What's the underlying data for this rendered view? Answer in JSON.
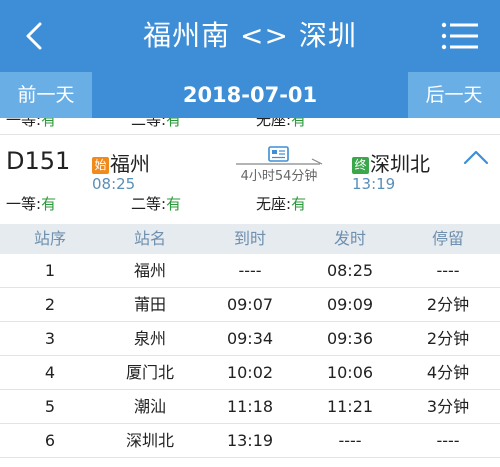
{
  "header": {
    "title": "福州南 <> 深圳",
    "back_icon": "chevron-left-icon",
    "menu_icon": "hamburger-menu-icon"
  },
  "datebar": {
    "prev_label": "前一天",
    "date": "2018-07-01",
    "next_label": "后一天"
  },
  "prev_train_seats": {
    "first_class": {
      "label": "一等:",
      "value": "有"
    },
    "second_class": {
      "label": "二等:",
      "value": "有"
    },
    "no_seat": {
      "label": "无座:",
      "value": "有"
    }
  },
  "train": {
    "code": "D151",
    "departure": {
      "badge": "始",
      "station": "福州",
      "time": "08:25"
    },
    "arrival": {
      "badge": "终",
      "station": "深圳北",
      "time": "13:19"
    },
    "duration": "4小时54分钟",
    "seats": {
      "first_class": {
        "label": "一等:",
        "value": "有"
      },
      "second_class": {
        "label": "二等:",
        "value": "有"
      },
      "no_seat": {
        "label": "无座:",
        "value": "有"
      }
    }
  },
  "stops_table": {
    "headers": [
      "站序",
      "站名",
      "到时",
      "发时",
      "停留"
    ],
    "rows": [
      [
        "1",
        "福州",
        "----",
        "08:25",
        "----"
      ],
      [
        "2",
        "莆田",
        "09:07",
        "09:09",
        "2分钟"
      ],
      [
        "3",
        "泉州",
        "09:34",
        "09:36",
        "2分钟"
      ],
      [
        "4",
        "厦门北",
        "10:02",
        "10:06",
        "4分钟"
      ],
      [
        "5",
        "潮汕",
        "11:18",
        "11:21",
        "3分钟"
      ],
      [
        "6",
        "深圳北",
        "13:19",
        "----",
        "----"
      ]
    ]
  },
  "colors": {
    "header_blue": "#3d8ed6",
    "date_button_blue": "#6aaee6",
    "available_green": "#2a9a3a",
    "table_header_bg": "#e6ebf0",
    "time_blue": "#5a8fb8"
  }
}
